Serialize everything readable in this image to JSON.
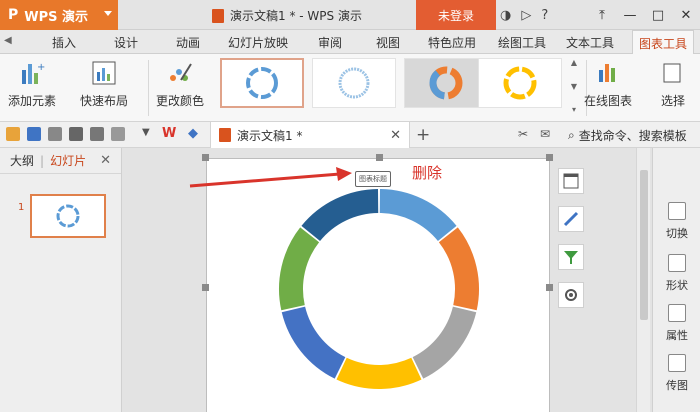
{
  "titlebar": {
    "app_name": "WPS 演示",
    "doc_title": "演示文稿1 * - WPS 演示",
    "login_label": "未登录",
    "help_label": "?",
    "colors": {
      "brand": "#e8782a",
      "login": "#e35d32"
    }
  },
  "tabs": [
    {
      "label": "插入"
    },
    {
      "label": "设计"
    },
    {
      "label": "动画"
    },
    {
      "label": "幻灯片放映"
    },
    {
      "label": "审阅"
    },
    {
      "label": "视图"
    },
    {
      "label": "特色应用"
    },
    {
      "label": "绘图工具"
    },
    {
      "label": "文本工具"
    },
    {
      "label": "图表工具"
    }
  ],
  "ribbon": {
    "add_element": "添加元素",
    "quick_layout": "快速布局",
    "change_color": "更改颜色",
    "online_chart": "在线图表",
    "select": "选择"
  },
  "quickbar": {
    "doc_tab": "演示文稿1 *",
    "search_label": "查找命令、搜索模板"
  },
  "leftpanel": {
    "outline_tab": "大纲",
    "slides_tab": "幻灯片",
    "slide_number": "1"
  },
  "canvas": {
    "title_placeholder": "图表标题",
    "annotation": "删除",
    "chart_colors": [
      "#5b9bd5",
      "#ed7d31",
      "#a5a5a5",
      "#ffc000",
      "#4472c4",
      "#70ad47",
      "#255e91"
    ]
  },
  "rightpanel": {
    "switch": "切换",
    "shape": "形状",
    "property": "属性",
    "send": "传图"
  }
}
